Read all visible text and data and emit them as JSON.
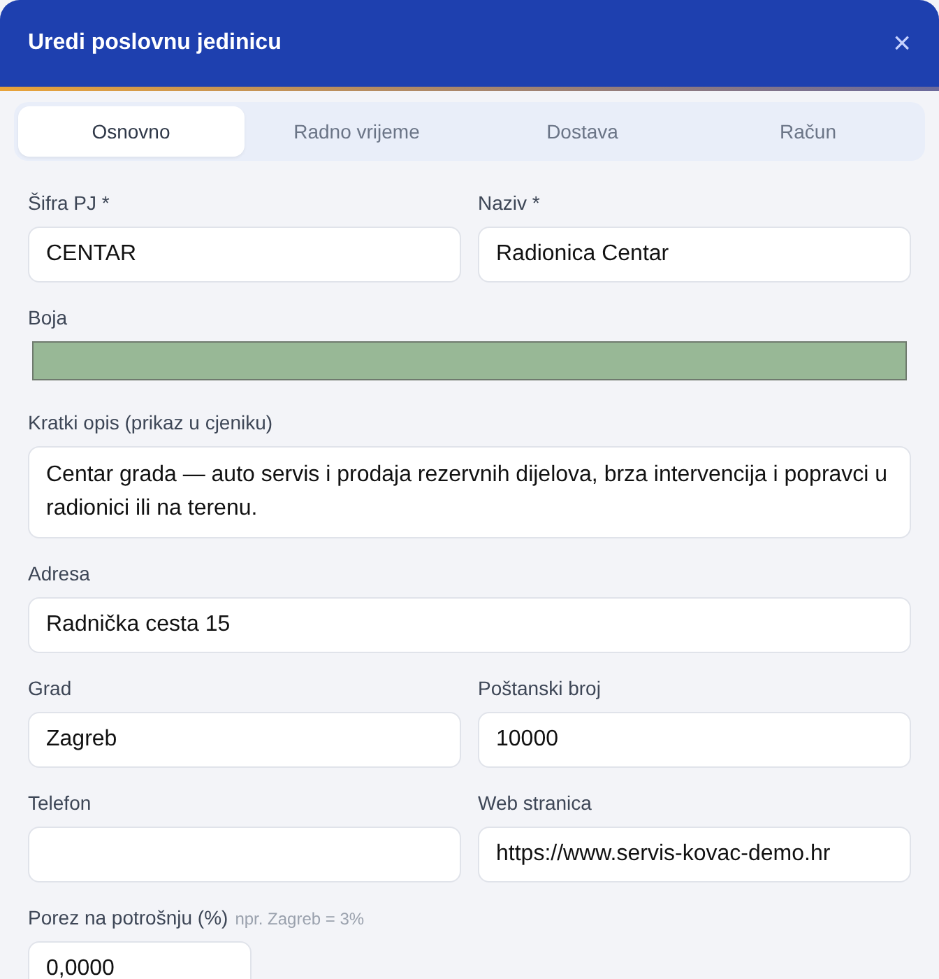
{
  "window": {
    "title": "Uredi poslovnu jedinicu",
    "close": "×"
  },
  "tabs": [
    {
      "label": "Osnovno",
      "selected": true
    },
    {
      "label": "Radno vrijeme",
      "selected": false
    },
    {
      "label": "Dostava",
      "selected": false
    },
    {
      "label": "Račun",
      "selected": false
    }
  ],
  "rows": [
    [
      {
        "kind": "text",
        "label": "Šifra PJ *",
        "value": "CENTAR"
      },
      {
        "kind": "text",
        "label": "Naziv *",
        "value": "Radionica Centar"
      }
    ],
    [
      {
        "kind": "color",
        "label": "Boja",
        "color": "#98b896"
      }
    ],
    [
      {
        "kind": "textarea",
        "label": "Kratki opis (prikaz u cjeniku)",
        "value": "Centar grada — auto servis i prodaja rezervnih dijelova, brza intervencija i popravci u radionici ili na terenu."
      }
    ],
    [
      {
        "kind": "text",
        "label": "Adresa",
        "value": "Radnička cesta 15"
      }
    ],
    [
      {
        "kind": "text",
        "label": "Grad",
        "value": "Zagreb"
      },
      {
        "kind": "text",
        "label": "Poštanski broj",
        "value": "10000"
      }
    ],
    [
      {
        "kind": "text",
        "label": "Telefon"
      },
      {
        "kind": "text",
        "label": "Web stranica",
        "value": "https://www.servis-kovac-demo.hr"
      }
    ],
    [
      {
        "kind": "short",
        "label": "Porez na potrošnju (%)",
        "hint": "npr. Zagreb = 3%",
        "value": "0,0000"
      }
    ]
  ]
}
